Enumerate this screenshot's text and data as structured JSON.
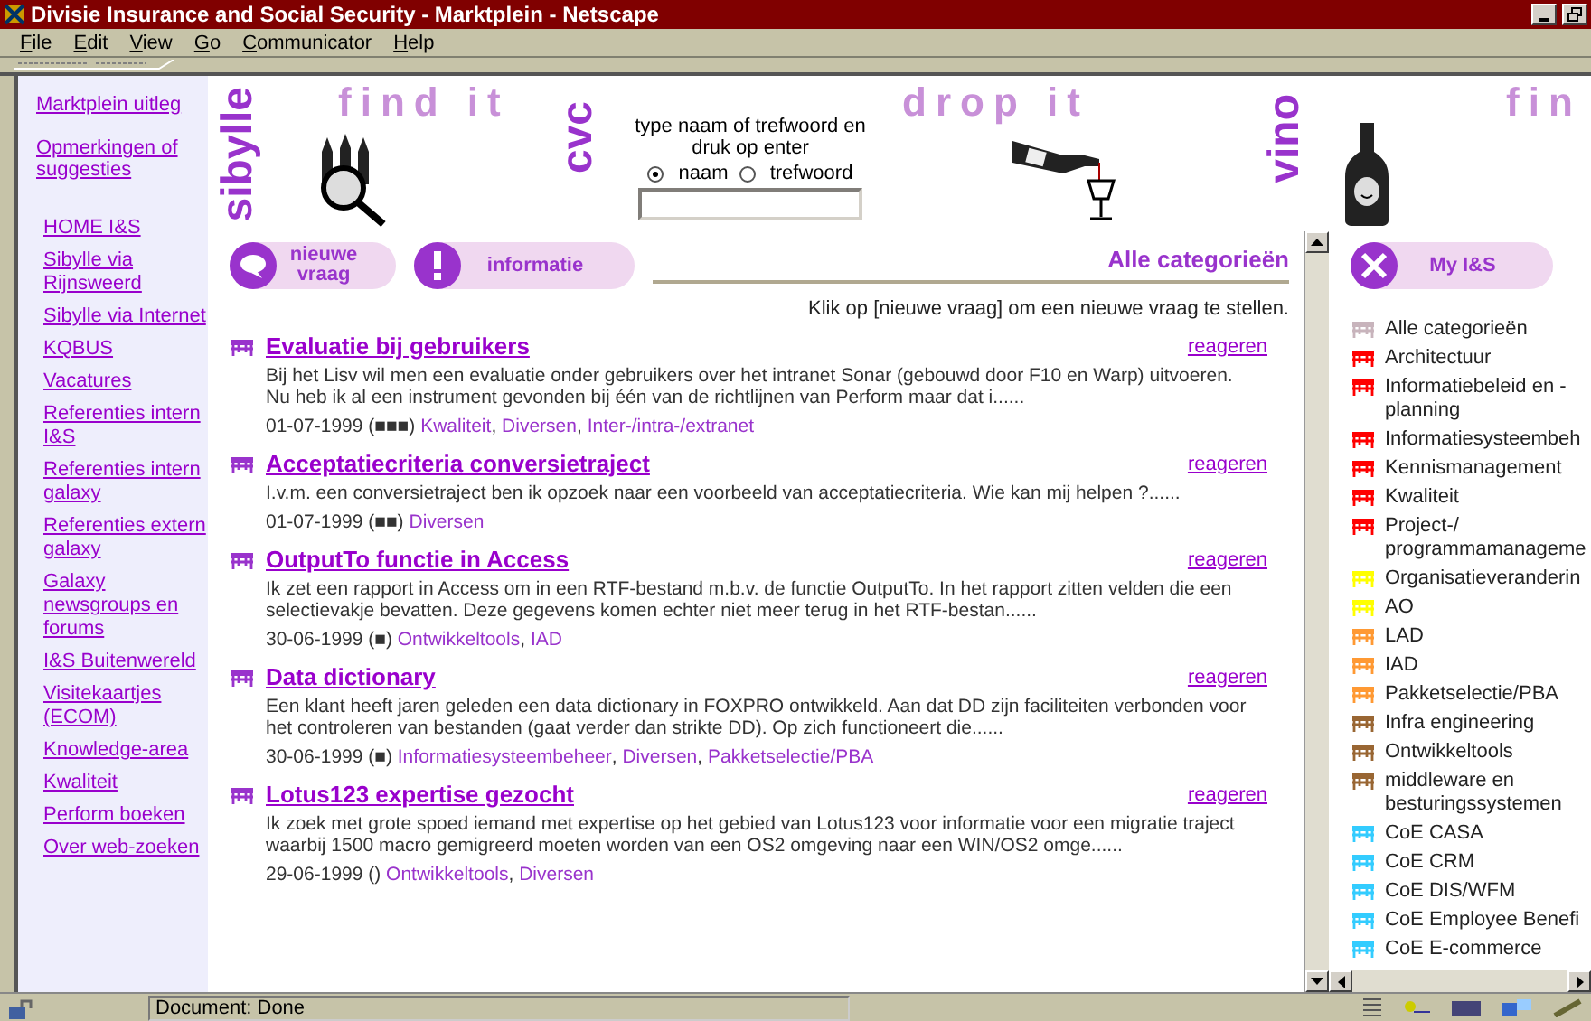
{
  "window": {
    "title": "Divisie Insurance and Social Security - Marktplein - Netscape"
  },
  "menu": [
    "File",
    "Edit",
    "View",
    "Go",
    "Communicator",
    "Help"
  ],
  "left_frame": {
    "top_links": [
      "Marktplein uitleg",
      "Opmerkingen of suggesties"
    ],
    "links": [
      "HOME I&S",
      "Sibylle via Rijnsweerd",
      "Sibylle via Internet",
      "KQBUS",
      "Vacatures",
      "Referenties intern I&S",
      "Referenties intern galaxy",
      "Referenties extern galaxy",
      "Galaxy newsgroups en forums",
      "I&S Buitenwereld",
      "Visitekaartjes (ECOM)",
      "Knowledge-area",
      "Kwaliteit",
      "Perform boeken",
      "Over web-zoeken"
    ]
  },
  "banner": {
    "words": [
      {
        "text": "find it",
        "kind": "faint"
      },
      {
        "text": "drop it",
        "kind": "faint"
      },
      {
        "text": "fin",
        "kind": "faint"
      },
      {
        "text": "sibylle",
        "kind": "vertical"
      },
      {
        "text": "cvc",
        "kind": "vertical"
      },
      {
        "text": "vino",
        "kind": "vertical"
      }
    ],
    "search": {
      "prompt": "type naam of trefwoord en druk op enter",
      "options": [
        {
          "label": "naam",
          "selected": true
        },
        {
          "label": "trefwoord",
          "selected": false
        }
      ]
    }
  },
  "main": {
    "buttons": [
      {
        "label": "nieuwe vraag",
        "kind": "question"
      },
      {
        "label": "informatie",
        "kind": "info"
      }
    ],
    "heading": "Alle categorieën",
    "category_separator": ",",
    "hint": "Klik op [nieuwe vraag] om een nieuwe vraag te stellen.",
    "posts": [
      {
        "title": "Evaluatie bij gebruikers",
        "action": "reageren",
        "body": "Bij het Lisv wil men een evaluatie onder gebruikers over het intranet Sonar (gebouwd door F10 en Warp) uitvoeren. Nu heb ik al een instrument gevonden bij één van de richtlijnen van Perform maar dat i......",
        "meta": "01-07-1999 (■■■)",
        "categories": [
          "Kwaliteit",
          "Diversen",
          "Inter-/intra-/extranet"
        ]
      },
      {
        "title": "Acceptatiecriteria conversietraject",
        "action": "reageren",
        "body": "I.v.m. een conversietraject ben ik opzoek naar een voorbeeld van acceptatiecriteria. Wie kan mij helpen ?......",
        "meta": "01-07-1999 (■■)",
        "categories": [
          "Diversen"
        ]
      },
      {
        "title": "OutputTo functie in Access",
        "action": "reageren",
        "body": "Ik zet een rapport in Access om in een RTF-bestand m.b.v. de functie OutputTo. In het rapport zitten velden die een selectievakje bevatten. Deze gegevens komen echter niet meer terug in het RTF-bestan......",
        "meta": "30-06-1999 (■)",
        "categories": [
          "Ontwikkeltools",
          "IAD"
        ]
      },
      {
        "title": "Data dictionary",
        "action": "reageren",
        "body": "Een klant heeft jaren geleden een data dictionary in FOXPRO ontwikkeld. Aan dat DD zijn faciliteiten verbonden voor het controleren van bestanden (gaat verder dan strikte DD). Op zich functioneert die......",
        "meta": "30-06-1999 (■)",
        "categories": [
          "Informatiesysteembeheer",
          "Diversen",
          "Pakketselectie/PBA"
        ]
      },
      {
        "title": "Lotus123 expertise gezocht",
        "action": "reageren",
        "body": "Ik zoek met grote spoed iemand met expertise op het gebied van Lotus123 voor informatie voor een migratie traject waarbij 1500 macro gemigreerd moeten worden van een OS2 omgeving naar een WIN/OS2 omge......",
        "meta": "29-06-1999 ()",
        "categories": [
          "Ontwikkeltools",
          "Diversen"
        ]
      }
    ]
  },
  "right_frame": {
    "button": "My I&S",
    "categories": [
      {
        "label": "Alle categorieën",
        "color": "#c8b4bc"
      },
      {
        "label": "Architectuur",
        "color": "#ff0000"
      },
      {
        "label": "Informatiebeleid en -planning",
        "color": "#ff0000"
      },
      {
        "label": "Informatiesysteembeh",
        "color": "#ff0000"
      },
      {
        "label": "Kennismanagement",
        "color": "#ff0000"
      },
      {
        "label": "Kwaliteit",
        "color": "#ff0000"
      },
      {
        "label": "Project-/ programmamanageme",
        "color": "#ff0000"
      },
      {
        "label": "Organisatieveranderin",
        "color": "#ffff00"
      },
      {
        "label": "AO",
        "color": "#ffff00"
      },
      {
        "label": "LAD",
        "color": "#ff9933"
      },
      {
        "label": "IAD",
        "color": "#ff9933"
      },
      {
        "label": "Pakketselectie/PBA",
        "color": "#ff9933"
      },
      {
        "label": "Infra engineering",
        "color": "#996633"
      },
      {
        "label": "Ontwikkeltools",
        "color": "#996633"
      },
      {
        "label": "middleware en besturingssystemen",
        "color": "#996633"
      },
      {
        "label": "CoE CASA",
        "color": "#33ccff"
      },
      {
        "label": "CoE CRM",
        "color": "#33ccff"
      },
      {
        "label": "CoE DIS/WFM",
        "color": "#33ccff"
      },
      {
        "label": "CoE Employee Benefi",
        "color": "#33ccff"
      },
      {
        "label": "CoE E-commerce",
        "color": "#33ccff"
      }
    ]
  },
  "status_bar": {
    "text": "Document: Done"
  }
}
